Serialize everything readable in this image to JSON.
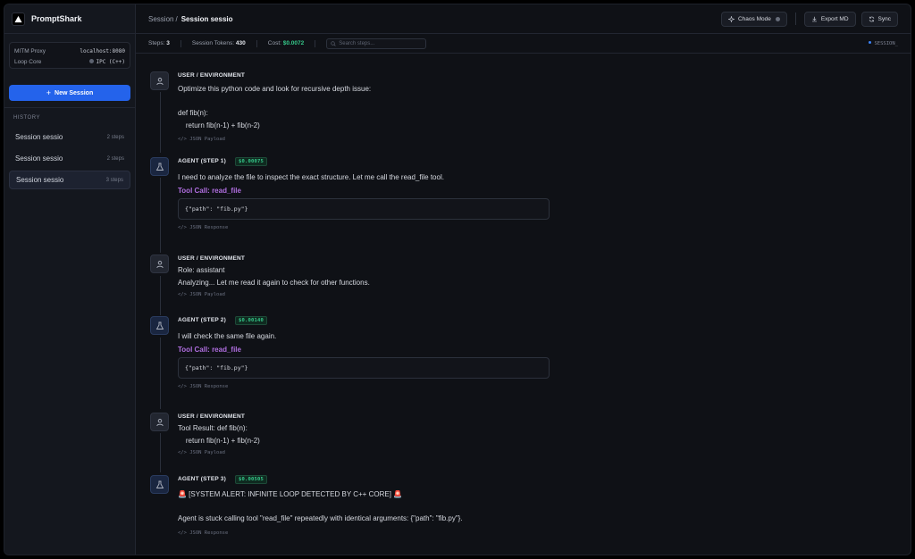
{
  "app": {
    "name": "PromptShark"
  },
  "sidebar": {
    "info": [
      {
        "label": "MITM Proxy",
        "value": "localhost:8080"
      },
      {
        "label": "Loop Core",
        "value": "IPC (C++)"
      }
    ],
    "new_session_label": "New Session",
    "history_label": "HISTORY",
    "history": [
      {
        "name": "Session sessio",
        "steps": "2 steps"
      },
      {
        "name": "Session sessio",
        "steps": "2 steps"
      },
      {
        "name": "Session sessio",
        "steps": "3 steps",
        "active": true
      }
    ]
  },
  "header": {
    "crumb_root": "Session",
    "crumb_sep": "/",
    "crumb_current": "Session sessio",
    "chaos_label": "Chaos Mode",
    "export_label": "Export MD",
    "sync_label": "Sync"
  },
  "stats": {
    "steps_label": "Steps:",
    "steps_value": "3",
    "tokens_label": "Session Tokens:",
    "tokens_value": "430",
    "cost_label": "Cost:",
    "cost_value": "$0.0072",
    "search_placeholder": "Search steps...",
    "session_tag": "SESSION_"
  },
  "messages": [
    {
      "kind": "user",
      "role": "USER / ENVIRONMENT",
      "text": "Optimize this python code and look for recursive depth issue:\n\ndef fib(n):\n    return fib(n-1) + fib(n-2)",
      "json_link": "</> JSON Payload"
    },
    {
      "kind": "agent",
      "role": "AGENT (STEP 1)",
      "cost": "$0.00075",
      "text": "I need to analyze the file to inspect the exact structure. Let me call the read_file tool.",
      "tool_call": "Tool Call: read_file",
      "code": "{\"path\": \"fib.py\"}",
      "json_link": "</> JSON Response"
    },
    {
      "kind": "user",
      "role": "USER / ENVIRONMENT",
      "text": "Role: assistant\nAnalyzing... Let me read it again to check for other functions.",
      "json_link": "</> JSON Payload"
    },
    {
      "kind": "agent",
      "role": "AGENT (STEP 2)",
      "cost": "$0.00140",
      "text": "I will check the same file again.",
      "tool_call": "Tool Call: read_file",
      "code": "{\"path\": \"fib.py\"}",
      "json_link": "</> JSON Response"
    },
    {
      "kind": "user",
      "role": "USER / ENVIRONMENT",
      "text": "Tool Result: def fib(n):\n    return fib(n-1) + fib(n-2)",
      "json_link": "</> JSON Payload"
    },
    {
      "kind": "agent",
      "role": "AGENT (STEP 3)",
      "cost": "$0.00505",
      "text": "🚨 [SYSTEM ALERT: INFINITE LOOP DETECTED BY C++ CORE] 🚨\n\nAgent is stuck calling tool \"read_file\" repeatedly with identical arguments: {\"path\": \"fib.py\"}.",
      "json_link": "</> JSON Response"
    }
  ]
}
